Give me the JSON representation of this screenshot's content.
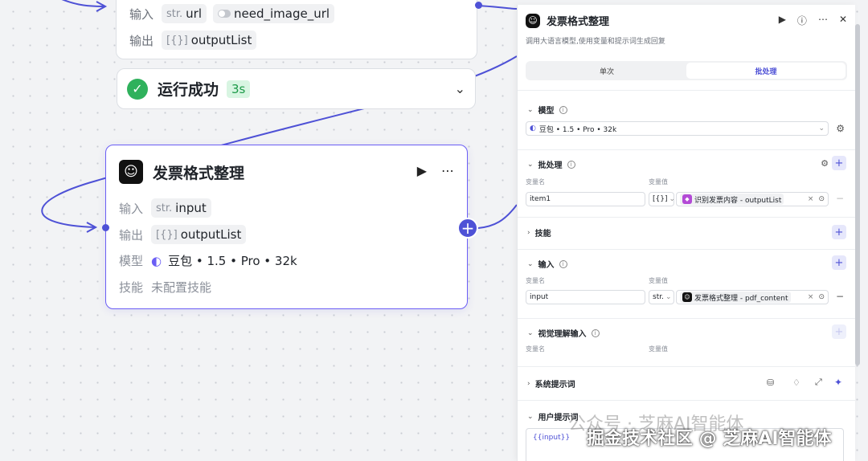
{
  "top_node": {
    "input_label": "输入",
    "output_label": "输出",
    "inputs": [
      {
        "prefix": "str.",
        "name": "url"
      },
      {
        "name": "need_image_url"
      }
    ],
    "outputs": [
      {
        "prefix": "[{}]",
        "name": "outputList"
      }
    ]
  },
  "run_status": {
    "text": "运行成功",
    "time": "3s"
  },
  "main_node": {
    "title": "发票格式整理",
    "input_label": "输入",
    "input_prefix": "str.",
    "input_name": "input",
    "output_label": "输出",
    "output_prefix": "[{}]",
    "output_name": "outputList",
    "model_label": "模型",
    "model_value": "豆包 • 1.5 • Pro • 32k",
    "skills_label": "技能",
    "skills_value": "未配置技能"
  },
  "panel": {
    "title": "发票格式整理",
    "description": "调用大语言模型,使用变量和提示词生成回复",
    "tabs": [
      {
        "label": "单次",
        "active": false
      },
      {
        "label": "批处理",
        "active": true
      }
    ],
    "model_section": {
      "title": "模型",
      "value": "豆包 • 1.5 • Pro • 32k"
    },
    "batch_section": {
      "title": "批处理",
      "var_name_header": "变量名",
      "var_value_header": "变量值",
      "name": "item1",
      "type": "[{}]",
      "ref": "识别发票内容 - outputList"
    },
    "skills_section": {
      "title": "技能"
    },
    "input_section": {
      "title": "输入",
      "var_name_header": "变量名",
      "var_value_header": "变量值",
      "name": "input",
      "type": "str.",
      "ref": "发票格式整理 - pdf_content"
    },
    "vision_section": {
      "title": "视觉理解输入",
      "var_name_header": "变量名",
      "var_value_header": "变量值"
    },
    "system_prompt_section": {
      "title": "系统提示词"
    },
    "user_prompt_section": {
      "title": "用户提示词",
      "content": "{{input}}"
    }
  },
  "watermark": {
    "line1": "公众号 · 芝麻AI智能体",
    "line2": "掘金技术社区 @ 芝麻AI智能体"
  },
  "colors": {
    "accent": "#4e51d6",
    "success": "#2fb15c",
    "node_border_selected": "#6b5ef5"
  },
  "icons": [
    "play-icon",
    "more-icon",
    "help-icon",
    "close-icon",
    "chevron-down-icon",
    "check-icon",
    "settings-icon",
    "plus-icon",
    "minus-icon"
  ]
}
